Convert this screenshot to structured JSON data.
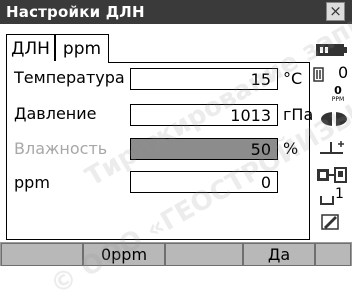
{
  "window": {
    "title": "Настройки ДЛН",
    "close_glyph": "×"
  },
  "tabs": [
    {
      "label": "ДЛН",
      "active": false
    },
    {
      "label": "ppm",
      "active": true
    }
  ],
  "fields": [
    {
      "label": "Температура",
      "value": "15",
      "unit": "°C",
      "disabled": false
    },
    {
      "label": "Давление",
      "value": "1013",
      "unit": "гПа",
      "disabled": false
    },
    {
      "label": "Влажность",
      "value": "50",
      "unit": "%",
      "disabled": true
    },
    {
      "label": "ppm",
      "value": "0",
      "unit": "",
      "disabled": false
    }
  ],
  "sidebar": {
    "prism_constant_value": "0",
    "ppm_value": "0",
    "ppm_label": "PPM",
    "page_number": "1",
    "icons": [
      "battery-icon",
      "prism-icon",
      "ppm-icon",
      "target-icon",
      "tilt-icon",
      "record-mode-icon",
      "page-icon",
      "pencil-icon"
    ]
  },
  "softkeys": [
    "",
    "0ppm",
    "",
    "Да",
    ""
  ],
  "watermark": {
    "line1": "Тиражирование запрещено",
    "line2": "© ООО «ГЕОСТРОЙИЗЫСКАНИЯ»"
  },
  "colors": {
    "titlebar": "#3a3a3a",
    "softkey_bar": "#9a9a9a",
    "disabled_field": "#8c8c8c"
  }
}
